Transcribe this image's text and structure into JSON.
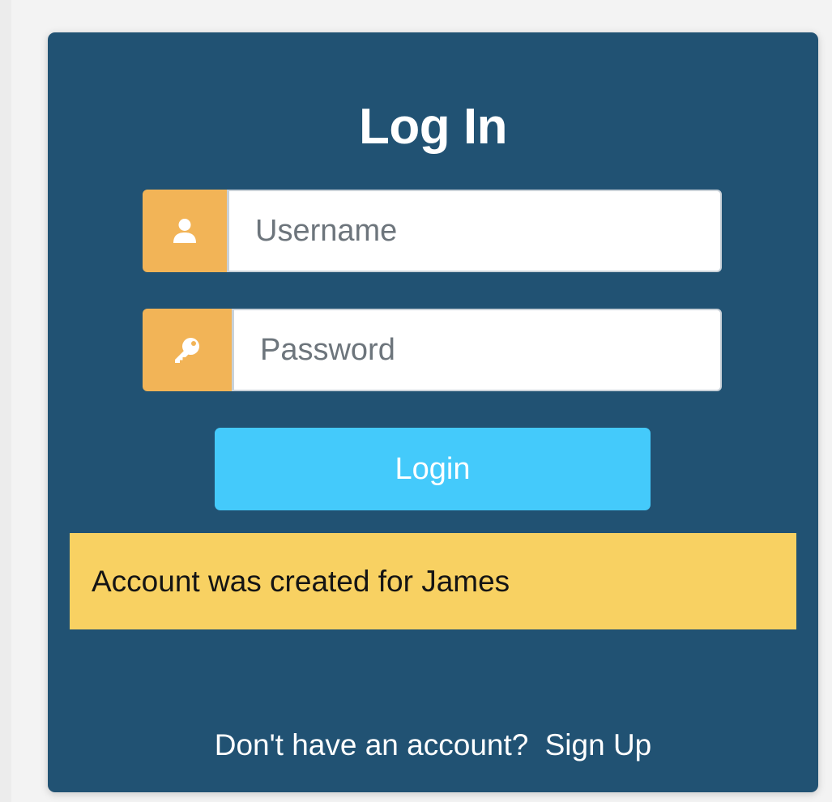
{
  "login_form": {
    "title": "Log In",
    "username": {
      "placeholder": "Username",
      "value": "",
      "icon": "user-icon"
    },
    "password": {
      "placeholder": "Password",
      "value": "",
      "icon": "key-icon"
    },
    "submit_label": "Login",
    "alert_message": "Account was created for James",
    "footer_text": "Don't have an account?",
    "signup_link": "Sign Up"
  },
  "colors": {
    "card_background": "#215273",
    "addon_background": "#f2b457",
    "button_background": "#44cafb",
    "alert_background": "#f8d162",
    "page_background": "#f3f3f3"
  }
}
